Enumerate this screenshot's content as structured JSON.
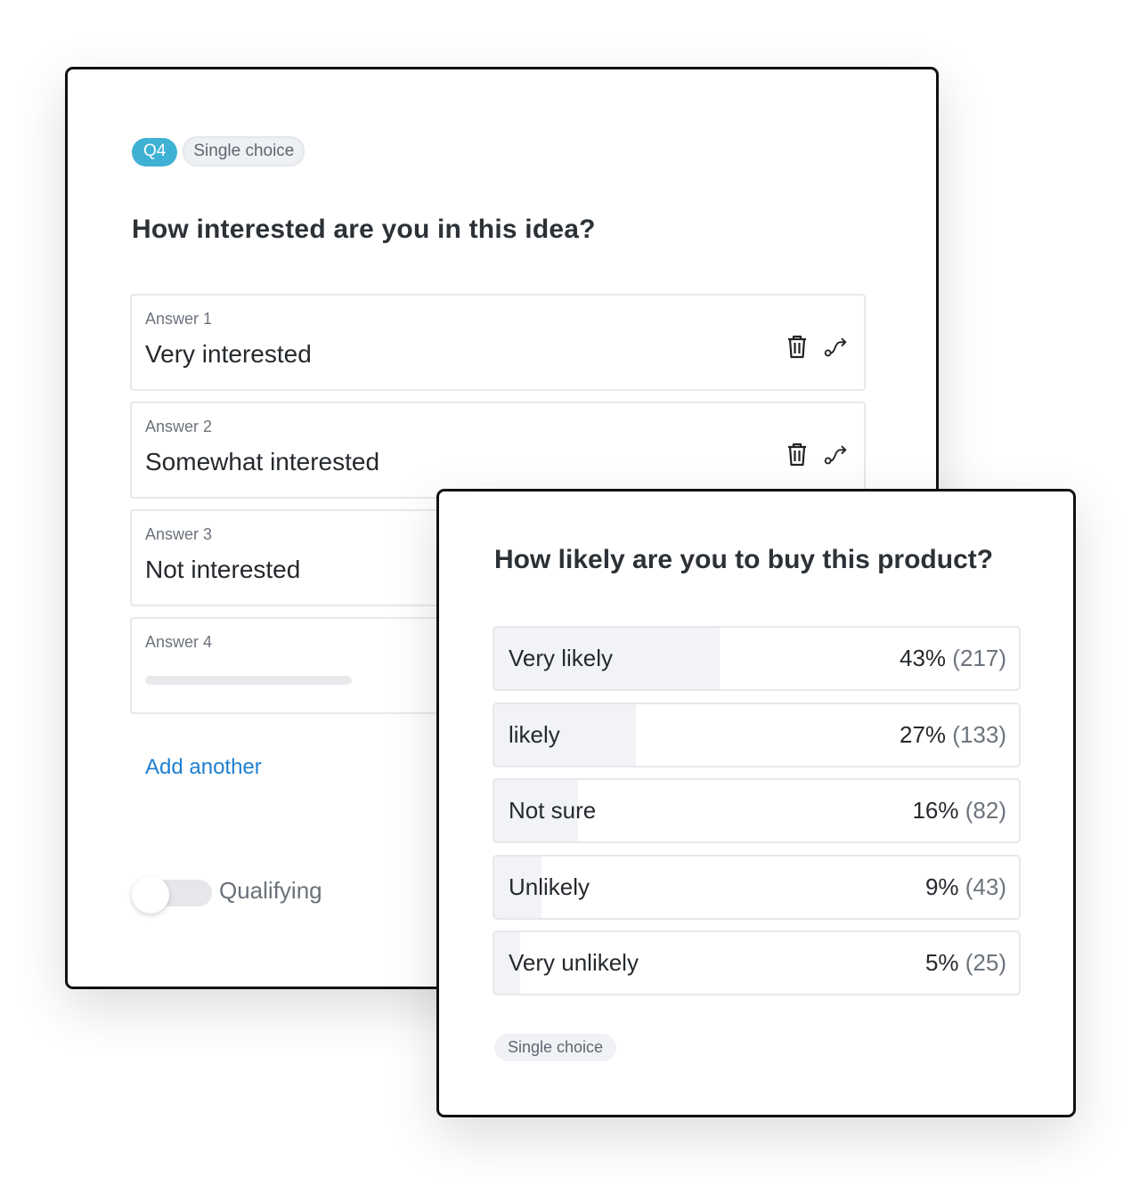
{
  "editor": {
    "question_number": "Q4",
    "question_type": "Single choice",
    "title": "How interested are you in this idea?",
    "answers": [
      {
        "label": "Answer 1",
        "value": "Very interested"
      },
      {
        "label": "Answer 2",
        "value": "Somewhat interested"
      },
      {
        "label": "Answer 3",
        "value": "Not interested"
      },
      {
        "label": "Answer 4",
        "value": ""
      }
    ],
    "add_link": "Add another",
    "toggle": {
      "label": "Qualifying",
      "on": false
    }
  },
  "results": {
    "title": "How likely are you to buy this product?",
    "type_badge": "Single choice",
    "fill_color": "#f2f3f6",
    "rows": [
      {
        "label": "Very likely",
        "percent_text": "43%",
        "count_text": "(217)",
        "fraction": 0.43
      },
      {
        "label": "likely",
        "percent_text": "27%",
        "count_text": "(133)",
        "fraction": 0.27
      },
      {
        "label": "Not sure",
        "percent_text": "16%",
        "count_text": "(82)",
        "fraction": 0.16
      },
      {
        "label": "Unlikely",
        "percent_text": "9%",
        "count_text": "(43)",
        "fraction": 0.09
      },
      {
        "label": "Very unlikely",
        "percent_text": "5%",
        "count_text": "(25)",
        "fraction": 0.05
      }
    ]
  },
  "colors": {
    "accent": "#3fb1d4",
    "link": "#1f7fd1"
  }
}
